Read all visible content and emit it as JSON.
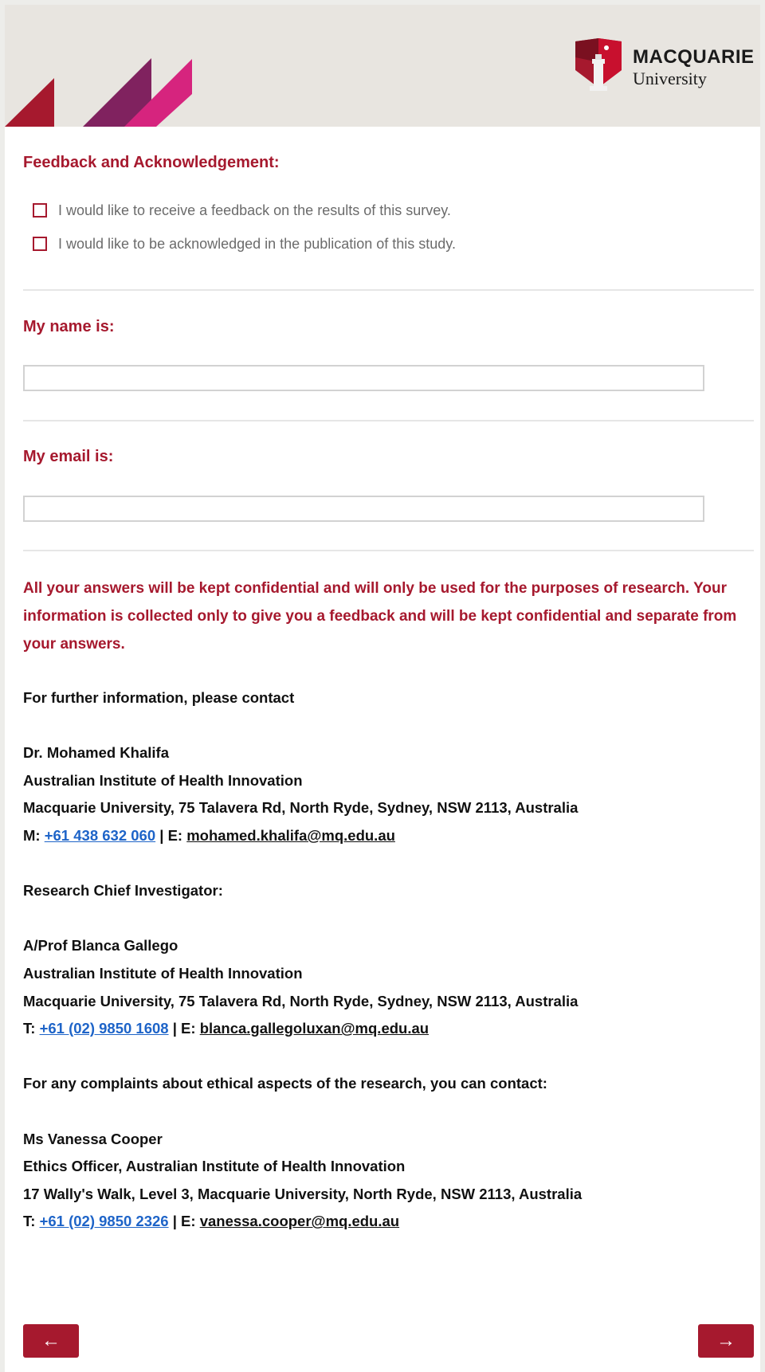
{
  "header": {
    "logo_line1": "MACQUARIE",
    "logo_line2": "University",
    "colors": {
      "red": "#a6192e",
      "purple": "#80225f",
      "magenta": "#d6247e"
    }
  },
  "feedback": {
    "heading": "Feedback and Acknowledgement:",
    "options": [
      {
        "label": "I would like to receive a feedback on the results of this survey.",
        "checked": false
      },
      {
        "label": "I would like to be acknowledged in the publication of this study.",
        "checked": false
      }
    ]
  },
  "name_field": {
    "heading": "My name is:",
    "value": "",
    "placeholder": ""
  },
  "email_field": {
    "heading": "My email is:",
    "value": "",
    "placeholder": ""
  },
  "notice": "All your answers will be kept confidential and will only be used for the purposes of research. Your information is collected only to give you a feedback and will be kept confidential and separate from your answers.",
  "contact1": {
    "intro": "For further information, please contact",
    "name": "Dr. Mohamed Khalifa",
    "org": "Australian Institute of Health Innovation",
    "address": "Macquarie University, 75 Talavera Rd, North Ryde, Sydney, NSW 2113, Australia",
    "phone_prefix": "M: ",
    "phone": "+61 438 632 060",
    "email_prefix": " | E: ",
    "email": "mohamed.khalifa@mq.edu.au"
  },
  "contact2": {
    "intro": "Research Chief Investigator:",
    "name": "A/Prof Blanca Gallego",
    "org": "Australian Institute of Health Innovation",
    "address": "Macquarie University, 75 Talavera Rd, North Ryde, Sydney, NSW 2113, Australia",
    "phone_prefix": "T: ",
    "phone": "+61 (02) 9850 1608",
    "email_prefix": " | E: ",
    "email": "blanca.gallegoluxan@mq.edu.au"
  },
  "contact3": {
    "intro": "For any complaints about ethical aspects of the research, you can contact:",
    "name": "Ms Vanessa Cooper",
    "org": "Ethics Officer, Australian Institute of Health Innovation",
    "address": "17 Wally's Walk, Level 3, Macquarie University, North Ryde, NSW 2113, Australia",
    "phone_prefix": "T: ",
    "phone": "+61 (02) 9850 2326",
    "email_prefix": " | E: ",
    "email": "vanessa.cooper@mq.edu.au"
  },
  "nav": {
    "back_label": "←",
    "next_label": "→"
  }
}
